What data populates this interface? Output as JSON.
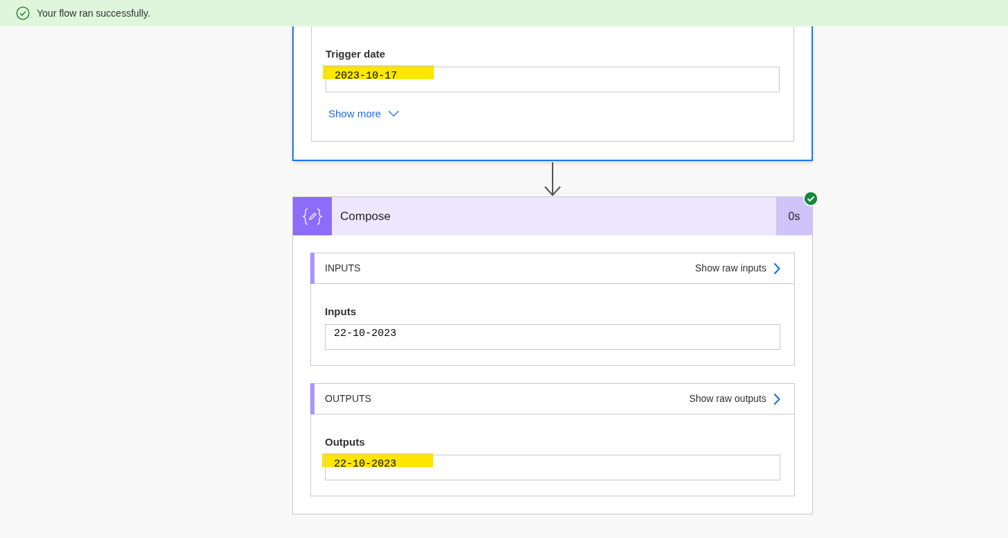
{
  "banner": {
    "message": "Your flow ran successfully."
  },
  "trigger_card": {
    "field": {
      "label": "Trigger date",
      "value": "2023-10-17",
      "highlighted": true
    },
    "show_more": "Show more"
  },
  "action": {
    "title": "Compose",
    "duration": "0s",
    "succeeded": true,
    "sections": [
      {
        "heading": "INPUTS",
        "link": "Show raw inputs",
        "field": {
          "label": "Inputs",
          "value": "22-10-2023",
          "highlighted": false
        }
      },
      {
        "heading": "OUTPUTS",
        "link": "Show raw outputs",
        "field": {
          "label": "Outputs",
          "value": "22-10-2023",
          "highlighted": true
        }
      }
    ]
  }
}
